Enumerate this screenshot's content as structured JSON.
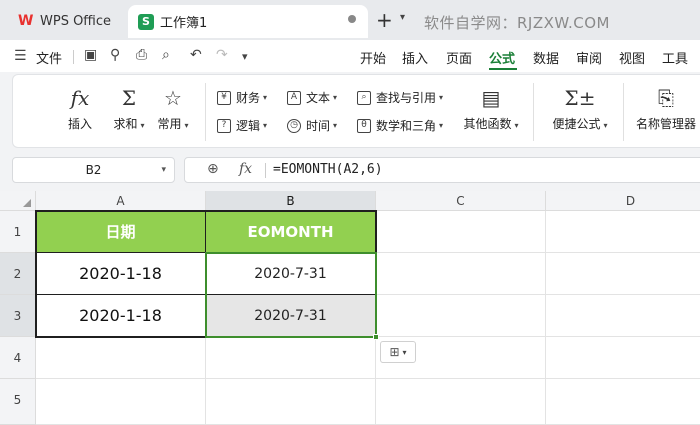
{
  "titlebar": {
    "app_tab": "WPS Office",
    "doc_tab": "工作簿1",
    "doc_icon_letter": "S",
    "watermark": "软件自学网：RJZXW.COM"
  },
  "menubar": {
    "file": "文件",
    "tabs": [
      "开始",
      "插入",
      "页面",
      "公式",
      "数据",
      "审阅",
      "视图",
      "工具"
    ],
    "active_tab": "公式"
  },
  "ribbon": {
    "insert": "插入",
    "sum": "求和",
    "common": "常用",
    "finance": "财务",
    "text": "文本",
    "lookup": "查找与引用",
    "logic": "逻辑",
    "time": "时间",
    "math": "数学和三角",
    "other": "其他函数",
    "quick_formula": "便捷公式",
    "name_manager": "名称管理器"
  },
  "formula_bar": {
    "cell_ref": "B2",
    "formula": "=EOMONTH(A2,6)"
  },
  "grid": {
    "columns": [
      "A",
      "B",
      "C",
      "D"
    ],
    "rows": [
      "1",
      "2",
      "3",
      "4",
      "5"
    ],
    "header_a": "日期",
    "header_b": "EOMONTH",
    "a2": "2020-1-18",
    "a3": "2020-1-18",
    "b2": "2020-7-31",
    "b3": "2020-7-31"
  },
  "colors": {
    "header_fill": "#92d050",
    "accent": "#1a7f37",
    "selection_border": "#3e8e2d"
  }
}
